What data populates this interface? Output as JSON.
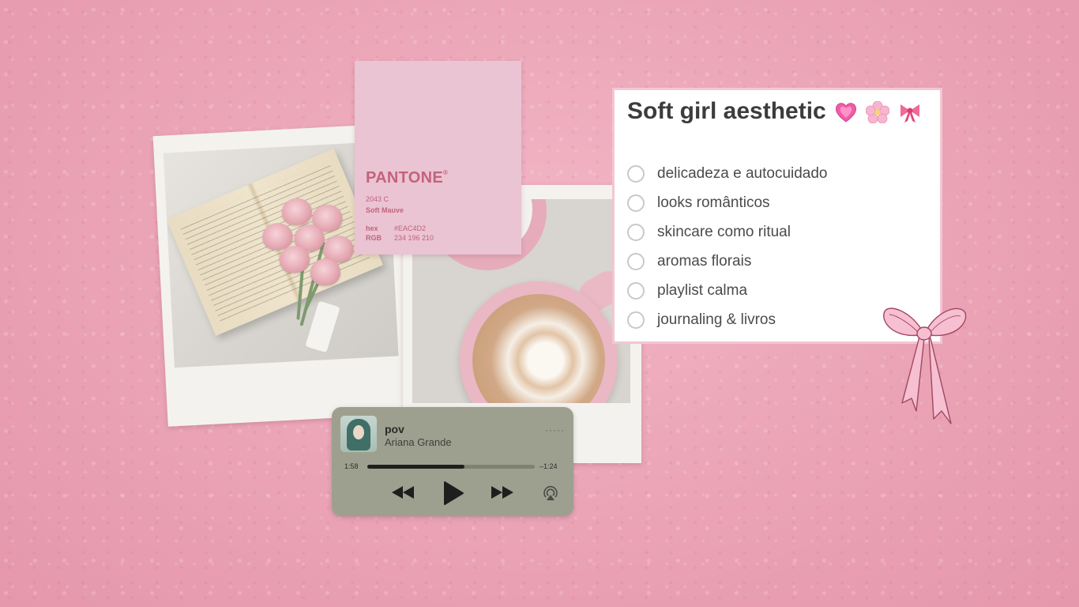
{
  "pantone": {
    "brand": "PANTONE",
    "registered": "®",
    "code": "2043 C",
    "name": "Soft Mauve",
    "hex_label": "hex",
    "hex_value": "#EAC4D2",
    "rgb_label": "RGB",
    "rgb_value": "234 196 210"
  },
  "checklist": {
    "title": "Soft girl aesthetic",
    "title_icons": [
      "heart-icon",
      "cherry-blossom-icon",
      "ribbon-icon"
    ],
    "items": [
      {
        "label": "delicadeza e autocuidado",
        "checked": false
      },
      {
        "label": "looks românticos",
        "checked": false
      },
      {
        "label": "skincare como ritual",
        "checked": false
      },
      {
        "label": "aromas florais",
        "checked": false
      },
      {
        "label": "playlist calma",
        "checked": false
      },
      {
        "label": "journaling & livros",
        "checked": false
      }
    ]
  },
  "player": {
    "title": "pov",
    "artist": "Ariana Grande",
    "more": "·····",
    "elapsed": "1:58",
    "remaining": "–1:24",
    "progress": 0.58,
    "controls": [
      "rewind-icon",
      "play-icon",
      "fast-forward-icon",
      "airplay-icon"
    ]
  },
  "colors": {
    "pantone_swatch": "#EAC4D2",
    "pantone_text": "#C4627E",
    "card_border": "#F3C6D3",
    "player_bg": "#9EA08F"
  }
}
